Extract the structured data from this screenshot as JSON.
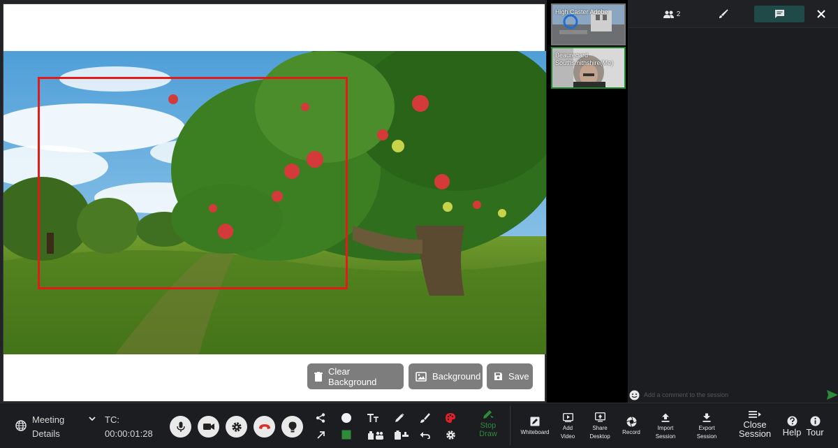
{
  "whiteboard": {
    "buttons": {
      "clear_background": "Clear Background",
      "background": "Background",
      "save": "Save"
    }
  },
  "participants": [
    {
      "name": "High Caster Adobe"
    },
    {
      "name": "Beauregard Southsmithshire(Me)"
    }
  ],
  "chat_panel": {
    "tabs": {
      "participants_count": "2",
      "participants_icon": "people-icon",
      "draw_icon": "brush-icon",
      "chat_icon": "chat-bubble-icon",
      "close_icon": "close-icon"
    },
    "input_placeholder": "Add a comment to the session",
    "active_tab_color": "#1f4a48"
  },
  "toolbar": {
    "meeting_label_1": "Meeting",
    "meeting_label_2": "Details",
    "tc_label": "TC:",
    "timecode": "00:00:01:28",
    "stop_draw_1": "Stop",
    "stop_draw_2": "Draw",
    "whiteboard": "Whiteboard",
    "add_video_1": "Add",
    "add_video_2": "Video",
    "share_desktop_1": "Share",
    "share_desktop_2": "Desktop",
    "record": "Record",
    "import_session_1": "Import",
    "import_session_2": "Session",
    "export_session_1": "Export",
    "export_session_2": "Session",
    "close_session_1": "Close",
    "close_session_2": "Session",
    "help": "Help",
    "tour": "Tour",
    "accent_green": "#2e8b3a",
    "hangup_red": "#d9302a"
  }
}
